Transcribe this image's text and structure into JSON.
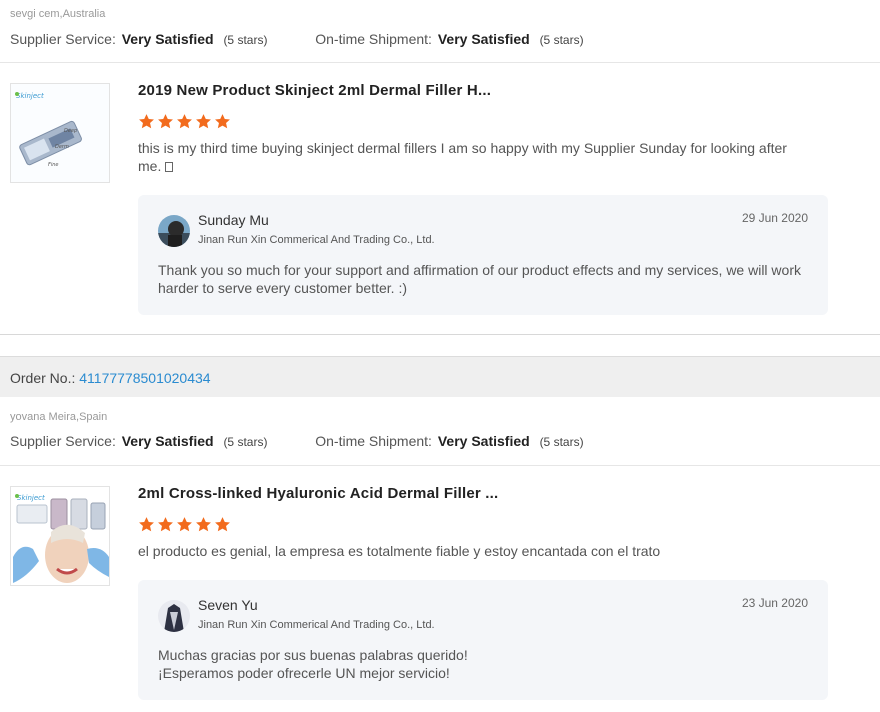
{
  "reviews": [
    {
      "buyer": "sevgi cem,Australia",
      "supplier_service_label": "Supplier Service:",
      "supplier_service_value": "Very Satisfied",
      "supplier_service_stars": "(5 stars)",
      "shipment_label": "On-time Shipment:",
      "shipment_value": "Very Satisfied",
      "shipment_stars": "(5 stars)",
      "product_title": "2019 New Product Skinject 2ml Dermal Filler H...",
      "product_thumb_text": [
        "Skinject",
        "Deep",
        "Derm",
        "Fine"
      ],
      "rating": 5,
      "text": "this is my third time buying skinject  dermal fillers I am so happy with my Supplier Sunday for looking after me. ",
      "reply": {
        "name": "Sunday Mu",
        "company": "Jinan Run Xin Commerical And Trading Co., Ltd.",
        "date": "29 Jun 2020",
        "text": "Thank you so much for your support and affirmation of our product effects and my services, we will work harder to serve every customer better.  :)"
      }
    },
    {
      "order_label": "Order No.:",
      "order_number": "41177778501020434",
      "buyer": "yovana Meira,Spain",
      "supplier_service_label": "Supplier Service:",
      "supplier_service_value": "Very Satisfied",
      "supplier_service_stars": "(5 stars)",
      "shipment_label": "On-time Shipment:",
      "shipment_value": "Very Satisfied",
      "shipment_stars": "(5 stars)",
      "product_title": "2ml Cross-linked Hyaluronic Acid Dermal Filler ...",
      "product_thumb_text": [
        "Skinject"
      ],
      "rating": 5,
      "text": "el producto es genial, la empresa es totalmente fiable y estoy encantada con el trato",
      "reply": {
        "name": "Seven Yu",
        "company": "Jinan Run Xin Commerical And Trading Co., Ltd.",
        "date": "23 Jun 2020",
        "text_line1": "Muchas gracias por sus buenas palabras querido!",
        "text_line2": "¡Esperamos poder ofrecerle UN mejor servicio!"
      }
    }
  ],
  "colors": {
    "star": "#f26b1d",
    "link": "#2a8bd0",
    "reply_bg": "#f4f6f9",
    "order_bar_bg": "#efefef"
  }
}
